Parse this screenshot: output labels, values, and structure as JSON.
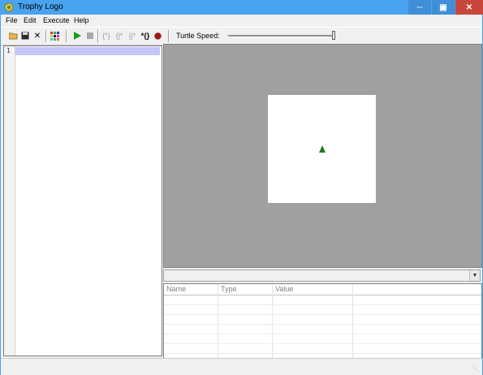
{
  "window": {
    "title": "Trophy Logo"
  },
  "menu": [
    "File",
    "Edit",
    "Execute",
    "Help"
  ],
  "toolbar": {
    "speed_label": "Turtle Speed:",
    "speed_value": 1.0,
    "icons": [
      "open-icon",
      "save-icon",
      "close-file-icon",
      "color-grid-icon",
      "run-icon",
      "stop-icon",
      "step-into-icon",
      "step-over-icon",
      "step-out-icon",
      "step-brace-icon",
      "record-icon"
    ]
  },
  "editor": {
    "line_numbers": [
      "1"
    ]
  },
  "variables": {
    "columns": [
      "Name",
      "Type",
      "Value"
    ]
  },
  "colors": {
    "title_bar": "#4aa3ee",
    "close_button": "#c7473c",
    "turtle": "#1e7a1e",
    "canvas_bg": "#a0a0a0",
    "current_line": "#c7c6fb"
  }
}
